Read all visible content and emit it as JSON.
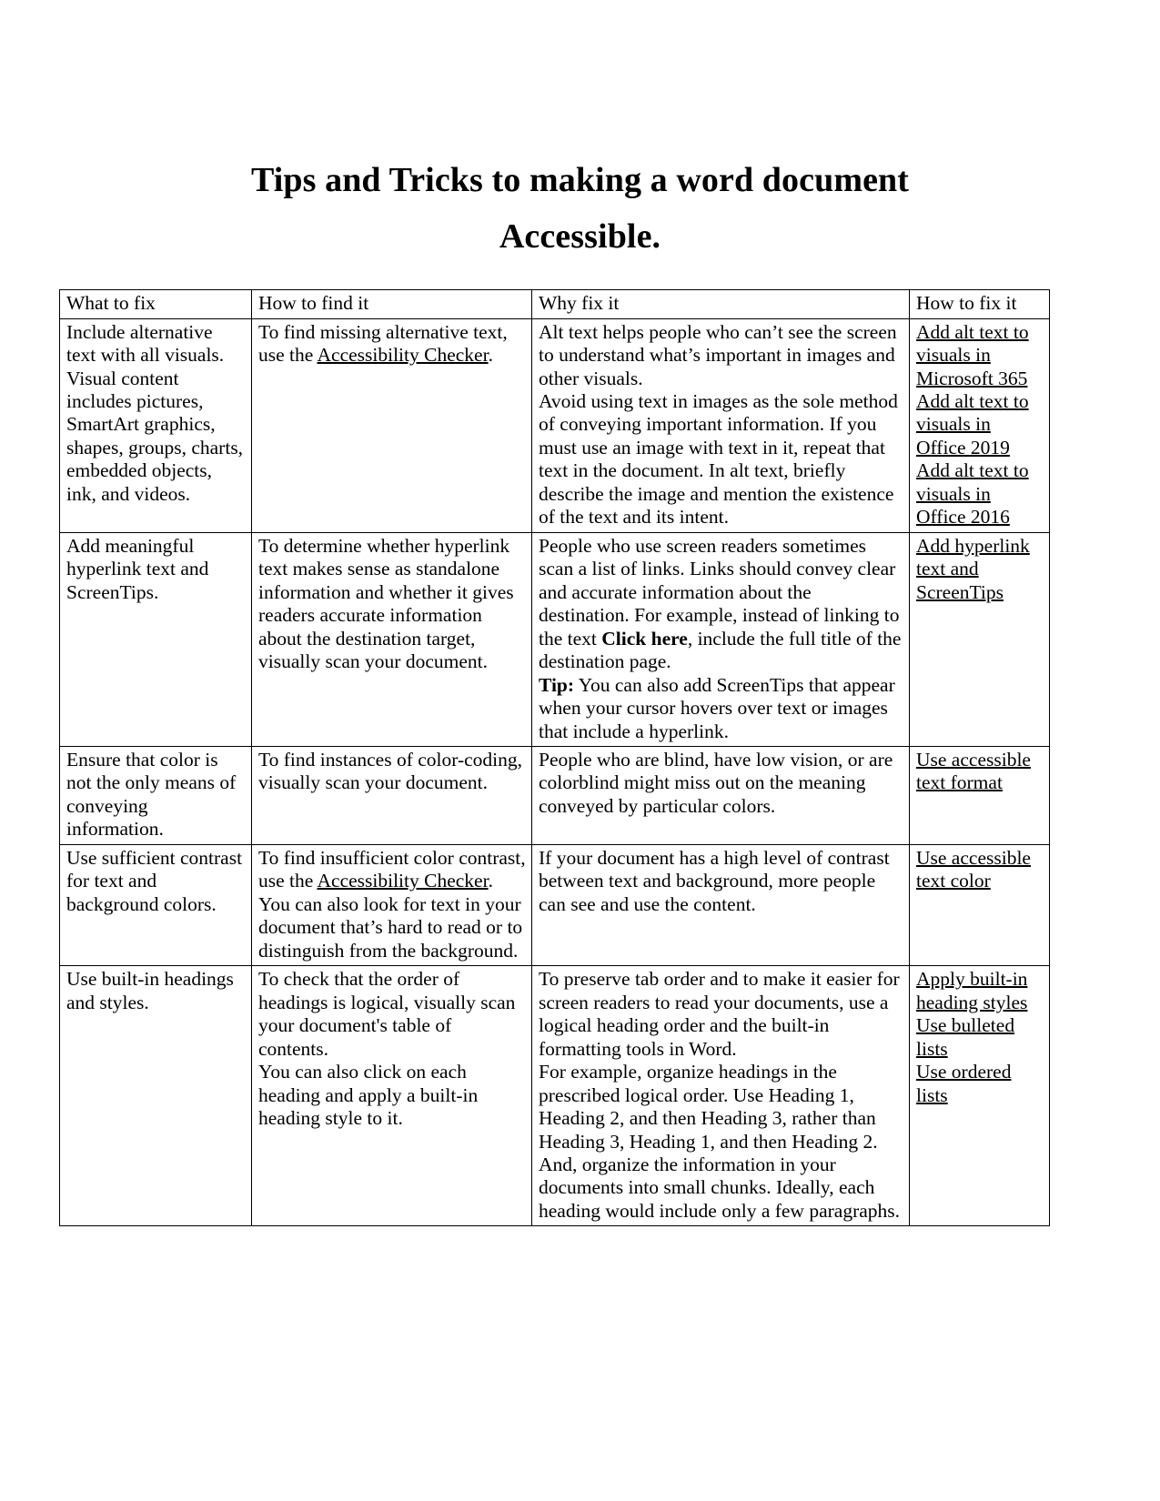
{
  "document": {
    "title_line1": "Tips and Tricks to making a word document",
    "title_line2": "Accessible."
  },
  "table": {
    "headers": [
      "What to fix",
      "How to find it",
      "Why fix it",
      "How to fix it"
    ],
    "rows": [
      {
        "what_to_fix": "Include alternative text with all visuals. Visual content includes pictures, SmartArt graphics, shapes, groups, charts, embedded objects, ink, and videos.",
        "how_to_find_pre": "To find missing alternative text, use the ",
        "how_to_find_link": "Accessibility Checker",
        "how_to_find_post": ".",
        "why_fix": [
          "Alt text helps people who can’t see the screen to understand what’s important in images and other visuals.",
          "Avoid using text in images as the sole method of conveying important information. If you must use an image with text in it, repeat that text in the document. In alt text, briefly describe the image and mention the existence of the text and its intent."
        ],
        "how_to_fix_links": [
          "Add alt text to visuals in Microsoft 365",
          "Add alt text to visuals in Office 2019",
          "Add alt text to visuals in Office 2016"
        ]
      },
      {
        "what_to_fix": "Add meaningful hyperlink text and ScreenTips.",
        "how_to_find": "To determine whether hyperlink text makes sense as standalone information and whether it gives readers accurate information about the destination target, visually scan your document.",
        "why_fix_p1_a": "People who use screen readers sometimes scan a list of links. Links should convey clear and accurate information about the destination. For example, instead of linking to the text ",
        "why_fix_p1_bold": "Click here",
        "why_fix_p1_b": ", include the full title of the destination page.",
        "why_fix_p2_bold": "Tip:",
        "why_fix_p2_text": " You can also add ScreenTips that appear when your cursor hovers over text or images that include a hyperlink.",
        "how_to_fix_links": [
          "Add hyperlink text and ScreenTips"
        ]
      },
      {
        "what_to_fix": "Ensure that color is not the only means of conveying information.",
        "how_to_find": "To find instances of color-coding, visually scan your document.",
        "why_fix": [
          "People who are blind, have low vision, or are colorblind might miss out on the meaning conveyed by particular colors."
        ],
        "how_to_fix_links": [
          "Use accessible text format"
        ]
      },
      {
        "what_to_fix": "Use sufficient contrast for text and background colors.",
        "how_to_find_pre": "To find insufficient color contrast, use the ",
        "how_to_find_link": "Accessibility Checker",
        "how_to_find_post": ".",
        "how_to_find_p2": "You can also look for text in your document that’s hard to read or to distinguish from the background.",
        "why_fix": [
          "If your document has a high level of contrast between text and background, more people can see and use the content."
        ],
        "how_to_fix_links": [
          "Use accessible text color"
        ]
      },
      {
        "what_to_fix": "Use built-in headings and styles.",
        "how_to_find_p1": "To check that the order of headings is logical, visually scan your document's table of contents.",
        "how_to_find_p2": "You can also click on each heading and apply a built-in heading style to it.",
        "why_fix": [
          "To preserve tab order and to make it easier for screen readers to read your documents, use a logical heading order and the built-in formatting tools in Word.",
          "For example, organize headings in the prescribed logical order. Use Heading 1, Heading 2, and then Heading 3, rather than Heading 3, Heading 1, and then Heading 2. And, organize the information in your documents into small chunks. Ideally, each heading would include only a few paragraphs."
        ],
        "how_to_fix_links": [
          "Apply built-in heading styles",
          "Use bulleted lists",
          "Use ordered lists"
        ]
      }
    ]
  }
}
